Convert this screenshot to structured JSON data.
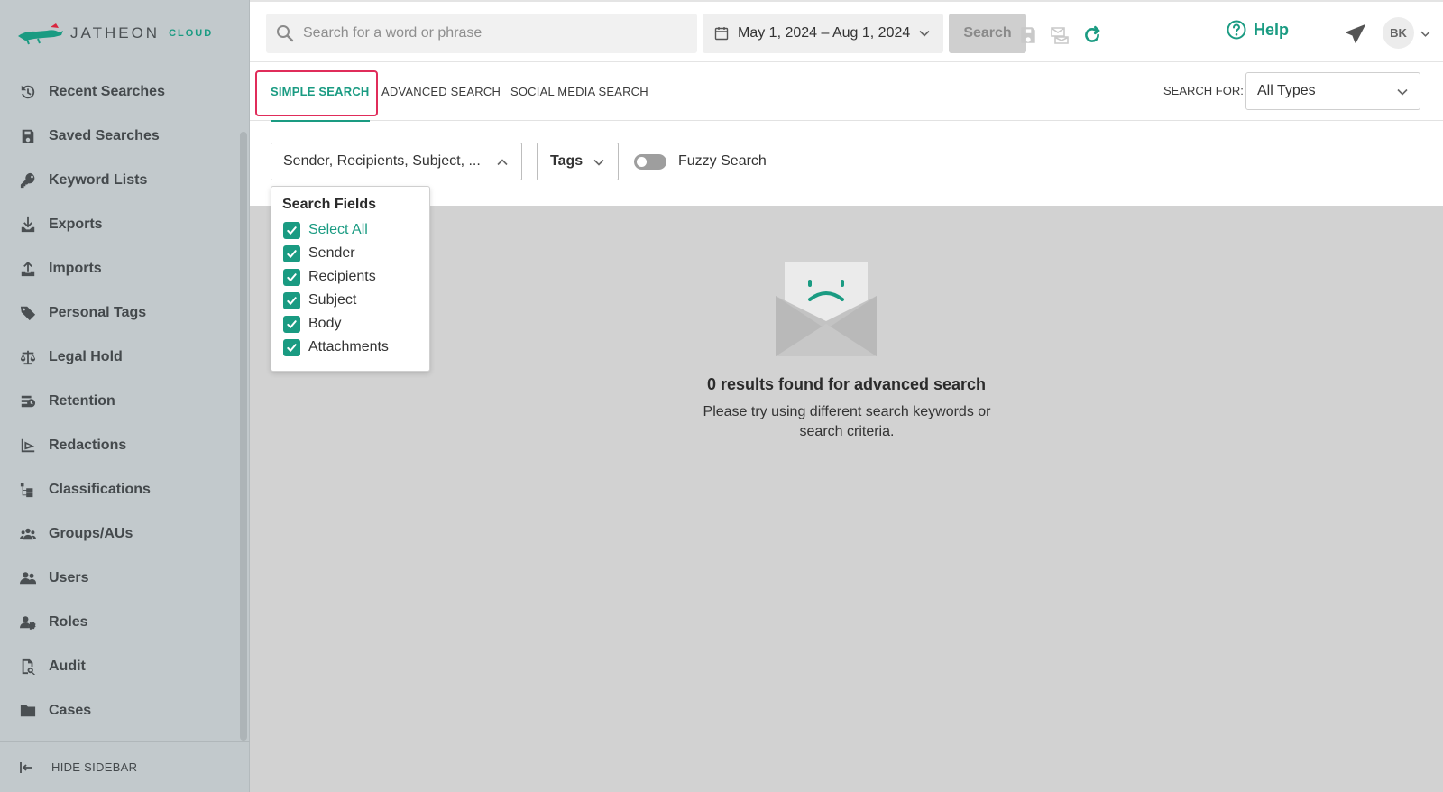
{
  "app": {
    "logo_text": "JATHEON",
    "logo_sub": "CLOUD"
  },
  "sidebar": {
    "items": [
      {
        "label": "Recent Searches",
        "icon": "history-icon"
      },
      {
        "label": "Saved Searches",
        "icon": "floppy-icon"
      },
      {
        "label": "Keyword Lists",
        "icon": "key-icon"
      },
      {
        "label": "Exports",
        "icon": "download-icon"
      },
      {
        "label": "Imports",
        "icon": "upload-icon"
      },
      {
        "label": "Personal Tags",
        "icon": "tag-icon"
      },
      {
        "label": "Legal Hold",
        "icon": "scale-icon"
      },
      {
        "label": "Retention",
        "icon": "retention-icon"
      },
      {
        "label": "Redactions",
        "icon": "redaction-icon"
      },
      {
        "label": "Classifications",
        "icon": "hierarchy-icon"
      },
      {
        "label": "Groups/AUs",
        "icon": "group-icon"
      },
      {
        "label": "Users",
        "icon": "users-icon"
      },
      {
        "label": "Roles",
        "icon": "roles-icon"
      },
      {
        "label": "Audit",
        "icon": "audit-icon"
      },
      {
        "label": "Cases",
        "icon": "folder-icon"
      }
    ],
    "hide_label": "HIDE SIDEBAR"
  },
  "topbar": {
    "search_placeholder": "Search for a word or phrase",
    "date_range": "May 1, 2024 – Aug 1, 2024",
    "search_button": "Search",
    "help_label": "Help",
    "user_initials": "BK"
  },
  "tabs": [
    {
      "label": "SIMPLE SEARCH",
      "active": true
    },
    {
      "label": "ADVANCED SEARCH",
      "active": false
    },
    {
      "label": "SOCIAL MEDIA SEARCH",
      "active": false
    }
  ],
  "search_for": {
    "label": "SEARCH FOR:",
    "value": "All Types"
  },
  "filters": {
    "fields_value": "Sender, Recipients, Subject, ...",
    "tags_label": "Tags",
    "fuzzy_label": "Fuzzy Search",
    "fuzzy_on": false
  },
  "search_fields_dropdown": {
    "title": "Search Fields",
    "items": [
      {
        "label": "Select All",
        "checked": true
      },
      {
        "label": "Sender",
        "checked": true
      },
      {
        "label": "Recipients",
        "checked": true
      },
      {
        "label": "Subject",
        "checked": true
      },
      {
        "label": "Body",
        "checked": true
      },
      {
        "label": "Attachments",
        "checked": true
      }
    ]
  },
  "empty_state": {
    "title": "0 results found for advanced search",
    "subtitle": "Please try using different search keywords or search criteria."
  },
  "colors": {
    "accent": "#1a9b82",
    "highlight": "#e02c5a",
    "sidebar_bg": "#c2c9cc",
    "main_bg": "#d2d2d2"
  }
}
